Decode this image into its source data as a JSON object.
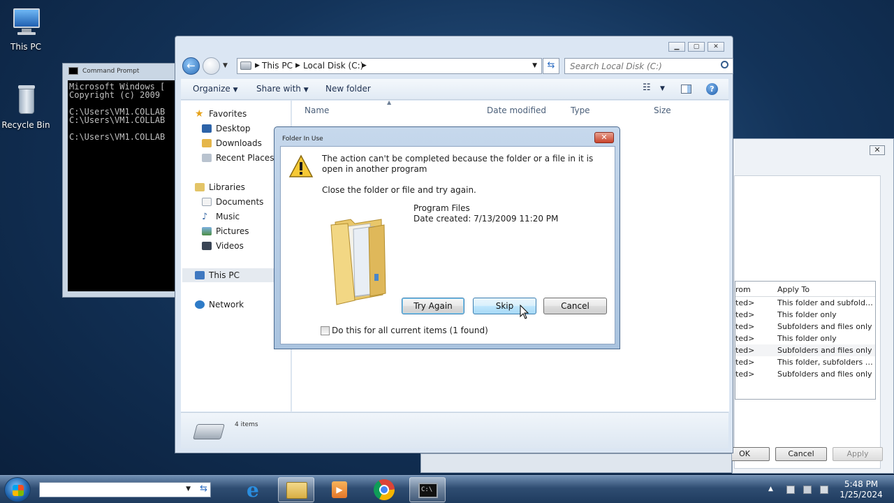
{
  "desktop": {
    "icons": [
      {
        "label": "This PC"
      },
      {
        "label": "Recycle Bin"
      }
    ]
  },
  "cmd": {
    "title": "Command Prompt",
    "lines": [
      "Microsoft Windows [",
      "Copyright (c) 2009",
      "",
      "C:\\Users\\VM1.COLLAB",
      "C:\\Users\\VM1.COLLAB",
      "",
      "C:\\Users\\VM1.COLLAB"
    ]
  },
  "props": {
    "close": "✕",
    "columns": [
      "rom",
      "Apply To"
    ],
    "rows": [
      [
        "ted>",
        "This folder and subfolders"
      ],
      [
        "ted>",
        "This folder only"
      ],
      [
        "ted>",
        "Subfolders and files only"
      ],
      [
        "ted>",
        "This folder only"
      ],
      [
        "ted>",
        "Subfolders and files only"
      ],
      [
        "ted>",
        "This folder, subfolders and files"
      ],
      [
        "ted>",
        "Subfolders and files only"
      ]
    ],
    "buttons": {
      "ok": "OK",
      "cancel": "Cancel",
      "apply": "Apply"
    }
  },
  "explorer": {
    "breadcrumb": [
      "This PC",
      "Local Disk (C:)"
    ],
    "search_placeholder": "Search Local Disk (C:)",
    "toolbar": {
      "organize": "Organize",
      "share_with": "Share with",
      "new_folder": "New folder"
    },
    "nav": {
      "favorites": "Favorites",
      "desktop": "Desktop",
      "downloads": "Downloads",
      "recent_places": "Recent Places",
      "libraries": "Libraries",
      "documents": "Documents",
      "music": "Music",
      "pictures": "Pictures",
      "videos": "Videos",
      "this_pc": "This PC",
      "network": "Network"
    },
    "columns": {
      "name": "Name",
      "date_modified": "Date modified",
      "type": "Type",
      "size": "Size"
    },
    "status": "4 items"
  },
  "dialog": {
    "title": "Folder In Use",
    "message": "The action can't be completed because the folder or a file in it is open in another program",
    "instruction": "Close the folder or file and try again.",
    "item_name": "Program Files",
    "item_date": "Date created: 7/13/2009 11:20 PM",
    "buttons": {
      "try_again": "Try Again",
      "skip": "Skip",
      "cancel": "Cancel"
    },
    "checkbox_label": "Do this for all current items (1 found)",
    "checkbox_checked": false
  },
  "taskbar": {
    "time": "5:48 PM",
    "date": "1/25/2024"
  },
  "colors": {
    "accent": "#3c7fb1",
    "close_red": "#c9432b"
  }
}
